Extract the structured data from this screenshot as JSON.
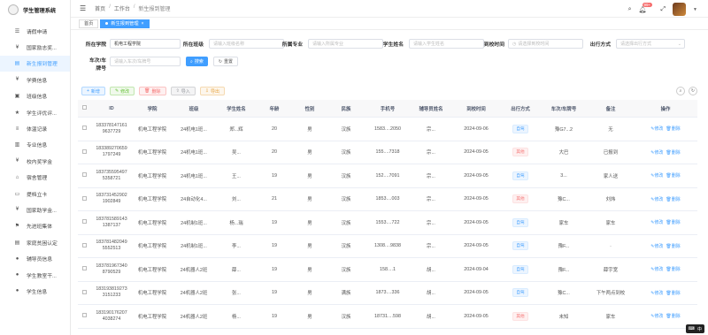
{
  "app": {
    "title": "学生管理系统"
  },
  "sidebar": {
    "items": [
      {
        "label": "请假申请",
        "icon": "leave-icon"
      },
      {
        "label": "国家励志奖...",
        "icon": "yen-icon"
      },
      {
        "label": "新生报到管理",
        "icon": "register-icon",
        "active": true
      },
      {
        "label": "学费信息",
        "icon": "yen-icon"
      },
      {
        "label": "班级信息",
        "icon": "class-icon"
      },
      {
        "label": "学生评优评...",
        "icon": "star-icon"
      },
      {
        "label": "体温记录",
        "icon": "list-icon"
      },
      {
        "label": "专业信息",
        "icon": "book-icon"
      },
      {
        "label": "校内奖学金",
        "icon": "yen-icon"
      },
      {
        "label": "宿舍管理",
        "icon": "home-icon"
      },
      {
        "label": "提档立卡",
        "icon": "card-icon"
      },
      {
        "label": "国家助学金...",
        "icon": "yen-icon"
      },
      {
        "label": "先进班集体",
        "icon": "group-icon"
      },
      {
        "label": "家庭贫困认定",
        "icon": "doc-icon"
      },
      {
        "label": "辅导员信息",
        "icon": "user-icon"
      },
      {
        "label": "学生教室干...",
        "icon": "user-icon"
      },
      {
        "label": "学生信息",
        "icon": "user-icon"
      }
    ]
  },
  "header": {
    "breadcrumbs": [
      "首页",
      "工作台",
      "新生报到管理"
    ],
    "notification_count": "99+"
  },
  "tabs": [
    {
      "label": "首页",
      "active": false
    },
    {
      "label": "新生报到管理",
      "active": true
    }
  ],
  "search": {
    "college_label": "所在学院",
    "college_value": "机电工程学院",
    "class_label": "所在班级",
    "class_placeholder": "请输入班级名称",
    "major_label": "所属专业",
    "major_placeholder": "请输入所属专业",
    "name_label": "学生姓名",
    "name_placeholder": "请输入学生姓名",
    "arrive_label": "到校时间",
    "arrive_placeholder": "请选择到校时间",
    "method_label": "出行方式",
    "method_placeholder": "请选择出行方式",
    "train_label_1": "车次/车",
    "train_label_2": "牌号",
    "train_placeholder": "请输入车次/车牌号",
    "search_btn": "搜索",
    "reset_btn": "重置"
  },
  "toolbar": {
    "add": "新增",
    "edit": "修改",
    "delete": "删除",
    "import": "导入",
    "export": "导出"
  },
  "table": {
    "headers": [
      "ID",
      "学院",
      "班级",
      "学生姓名",
      "年龄",
      "性别",
      "民族",
      "手机号",
      "辅导员姓名",
      "到校时间",
      "出行方式",
      "车次/车牌号",
      "备注",
      "操作"
    ],
    "edit_label": "修改",
    "delete_label": "删除",
    "rows": [
      {
        "id1": "183378147161",
        "id2": "9637729",
        "college": "机电工程学院",
        "class": "24机电1班...",
        "name": "郑...辉",
        "age": "20",
        "gender": "男",
        "ethnic": "汉族",
        "phone": "1583....2050",
        "counselor": "宗...",
        "date": "2024-09-06",
        "method": "自驾",
        "method_color": "blue",
        "train": "豫G7...2",
        "remark": "无"
      },
      {
        "id1": "183389270659",
        "id2": "1797249",
        "college": "机电工程学院",
        "class": "24机电1班...",
        "name": "吴...",
        "age": "20",
        "gender": "男",
        "ethnic": "汉族",
        "phone": "155....7318",
        "counselor": "宗...",
        "date": "2024-09-05",
        "method": "其他",
        "method_color": "red",
        "train": "大巴",
        "remark": "已报到"
      },
      {
        "id1": "183735595497",
        "id2": "5358721",
        "college": "机电工程学院",
        "class": "24机电1班...",
        "name": "王...",
        "age": "19",
        "gender": "男",
        "ethnic": "汉族",
        "phone": "152....7091",
        "counselor": "宗...",
        "date": "2024-09-05",
        "method": "自驾",
        "method_color": "blue",
        "train": "3...",
        "remark": "家人送"
      },
      {
        "id1": "183731452902",
        "id2": "1902849",
        "college": "机电工程学院",
        "class": "24自动化4...",
        "name": "刘...",
        "age": "21",
        "gender": "男",
        "ethnic": "汉族",
        "phone": "1853....003",
        "counselor": "宗...",
        "date": "2024-09-05",
        "method": "其他",
        "method_color": "red",
        "train": "豫C...",
        "remark": "刘炜"
      },
      {
        "id1": "183781589143",
        "id2": "1387137",
        "college": "机电工程学院",
        "class": "24机制1班...",
        "name": "杨...瑞",
        "age": "19",
        "gender": "男",
        "ethnic": "汉族",
        "phone": "1553....722",
        "counselor": "宗...",
        "date": "2024-09-05",
        "method": "自驾",
        "method_color": "blue",
        "train": "家车",
        "remark": "家车"
      },
      {
        "id1": "183781482049",
        "id2": "5552513",
        "college": "机电工程学院",
        "class": "24机制1班...",
        "name": "李...",
        "age": "19",
        "gender": "男",
        "ethnic": "汉族",
        "phone": "1308....9838",
        "counselor": "宗...",
        "date": "2024-09-05",
        "method": "自驾",
        "method_color": "blue",
        "train": "豫F...",
        "remark": "."
      },
      {
        "id1": "183781967340",
        "id2": "8790529",
        "college": "机电工程学院",
        "class": "24机器人2班",
        "name": "薛...",
        "age": "19",
        "gender": "男",
        "ethnic": "汉族",
        "phone": "158....1",
        "counselor": "胡...",
        "date": "2024-09-04",
        "method": "自驾",
        "method_color": "blue",
        "train": "豫F...",
        "remark": "薛宇宽"
      },
      {
        "id1": "183193819273",
        "id2": "3151233",
        "college": "机电工程学院",
        "class": "24机器人2班",
        "name": "张...",
        "age": "19",
        "gender": "男",
        "ethnic": "满族",
        "phone": "1873....336",
        "counselor": "胡...",
        "date": "2024-09-05",
        "method": "自驾",
        "method_color": "blue",
        "train": "豫C...",
        "remark": "下午两点到校"
      },
      {
        "id1": "183190176207",
        "id2": "4038274",
        "college": "机电工程学院",
        "class": "24机器人2班",
        "name": "杨...",
        "age": "19",
        "gender": "男",
        "ethnic": "汉族",
        "phone": "18731....598",
        "counselor": "胡...",
        "date": "2024-09-05",
        "method": "其他",
        "method_color": "red",
        "train": "未知",
        "remark": "家车"
      }
    ]
  },
  "corner": {
    "label": "中",
    "icon": "keyboard-icon"
  }
}
